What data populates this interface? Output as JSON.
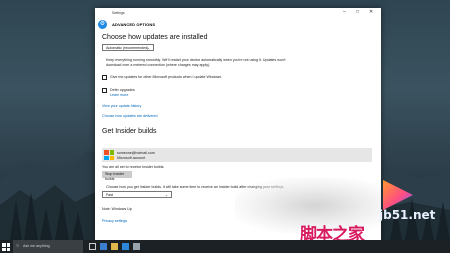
{
  "window": {
    "title": "Settings",
    "header": "ADVANCED OPTIONS"
  },
  "updates": {
    "section_title": "Choose how updates are installed",
    "mode_selected": "Automatic (recommended)",
    "mode_desc_line1": "Keep everything running smoothly. We'll restart your device automatically when you're not using it. Updates won't",
    "mode_desc_line2": "download over a metered connection (where charges may apply).",
    "other_products_label": "Give me updates for other Microsoft products when I update Windows.",
    "defer_label": "Defer upgrades",
    "learn_more": "Learn more",
    "history_link": "View your update history",
    "delivery_link": "Choose how updates are delivered"
  },
  "insider": {
    "section_title": "Get Insider builds",
    "account_email": "someone@hotmail.com",
    "account_type": "Microsoft account",
    "ready_text": "You are all set to receive Insider builds.",
    "stop_button": "Stop Insider builds",
    "pace_text": "Choose how you get Insider builds. It will take some time to receive an Insider build after changing your settings.",
    "pace_selected": "Fast",
    "note_text": "Note: Windows Up",
    "privacy_link": "Privacy settings"
  },
  "taskbar": {
    "search_placeholder": "Ask me anything"
  },
  "watermark": {
    "site": "jb51.net",
    "cn_text": "脚本之家"
  },
  "colors": {
    "accent": "#0067b8",
    "gear": "#1e88e5",
    "taskbar": "#1c2126"
  }
}
